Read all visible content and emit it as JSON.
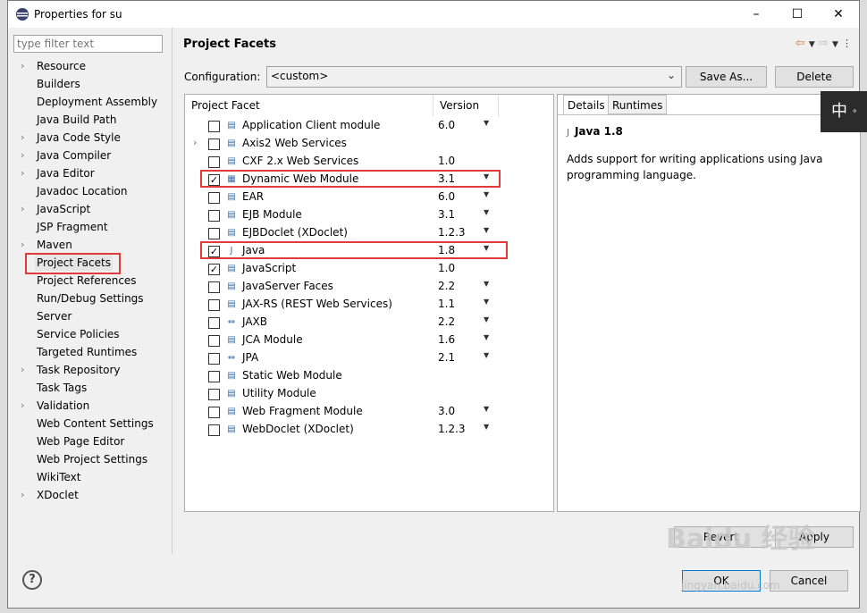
{
  "window": {
    "title": "Properties for su"
  },
  "filter": {
    "placeholder": "type filter text"
  },
  "nav": [
    {
      "label": "Resource",
      "expandable": true
    },
    {
      "label": "Builders",
      "expandable": false
    },
    {
      "label": "Deployment Assembly",
      "expandable": false
    },
    {
      "label": "Java Build Path",
      "expandable": false
    },
    {
      "label": "Java Code Style",
      "expandable": true
    },
    {
      "label": "Java Compiler",
      "expandable": true
    },
    {
      "label": "Java Editor",
      "expandable": true
    },
    {
      "label": "Javadoc Location",
      "expandable": false
    },
    {
      "label": "JavaScript",
      "expandable": true
    },
    {
      "label": "JSP Fragment",
      "expandable": false
    },
    {
      "label": "Maven",
      "expandable": true
    },
    {
      "label": "Project Facets",
      "expandable": false,
      "selected": true
    },
    {
      "label": "Project References",
      "expandable": false
    },
    {
      "label": "Run/Debug Settings",
      "expandable": false
    },
    {
      "label": "Server",
      "expandable": false
    },
    {
      "label": "Service Policies",
      "expandable": false
    },
    {
      "label": "Targeted Runtimes",
      "expandable": false
    },
    {
      "label": "Task Repository",
      "expandable": true
    },
    {
      "label": "Task Tags",
      "expandable": false
    },
    {
      "label": "Validation",
      "expandable": true
    },
    {
      "label": "Web Content Settings",
      "expandable": false
    },
    {
      "label": "Web Page Editor",
      "expandable": false
    },
    {
      "label": "Web Project Settings",
      "expandable": false
    },
    {
      "label": "WikiText",
      "expandable": false
    },
    {
      "label": "XDoclet",
      "expandable": true
    }
  ],
  "page": {
    "title": "Project Facets",
    "configuration_label": "Configuration:",
    "configuration_value": "<custom>",
    "save_as": "Save As...",
    "delete": "Delete"
  },
  "facets": {
    "col_facet": "Project Facet",
    "col_version": "Version",
    "rows": [
      {
        "label": "Application Client module",
        "version": "6.0",
        "checked": false,
        "dropdown": true,
        "expand": false,
        "icon": "file-icon"
      },
      {
        "label": "Axis2 Web Services",
        "version": "",
        "checked": false,
        "dropdown": false,
        "expand": true,
        "icon": "file-icon"
      },
      {
        "label": "CXF 2.x Web Services",
        "version": "1.0",
        "checked": false,
        "dropdown": false,
        "expand": false,
        "icon": "file-icon"
      },
      {
        "label": "Dynamic Web Module",
        "version": "3.1",
        "checked": true,
        "dropdown": true,
        "expand": false,
        "icon": "web-module-icon",
        "highlight": true
      },
      {
        "label": "EAR",
        "version": "6.0",
        "checked": false,
        "dropdown": true,
        "expand": false,
        "icon": "file-icon"
      },
      {
        "label": "EJB Module",
        "version": "3.1",
        "checked": false,
        "dropdown": true,
        "expand": false,
        "icon": "ejb-icon"
      },
      {
        "label": "EJBDoclet (XDoclet)",
        "version": "1.2.3",
        "checked": false,
        "dropdown": true,
        "expand": false,
        "icon": "file-icon"
      },
      {
        "label": "Java",
        "version": "1.8",
        "checked": true,
        "dropdown": true,
        "expand": false,
        "icon": "java-icon",
        "highlight": true
      },
      {
        "label": "JavaScript",
        "version": "1.0",
        "checked": true,
        "dropdown": false,
        "expand": false,
        "icon": "file-icon"
      },
      {
        "label": "JavaServer Faces",
        "version": "2.2",
        "checked": false,
        "dropdown": true,
        "expand": false,
        "icon": "file-icon"
      },
      {
        "label": "JAX-RS (REST Web Services)",
        "version": "1.1",
        "checked": false,
        "dropdown": true,
        "expand": false,
        "icon": "file-icon"
      },
      {
        "label": "JAXB",
        "version": "2.2",
        "checked": false,
        "dropdown": true,
        "expand": false,
        "icon": "jaxb-icon"
      },
      {
        "label": "JCA Module",
        "version": "1.6",
        "checked": false,
        "dropdown": true,
        "expand": false,
        "icon": "file-icon"
      },
      {
        "label": "JPA",
        "version": "2.1",
        "checked": false,
        "dropdown": true,
        "expand": false,
        "icon": "jpa-icon"
      },
      {
        "label": "Static Web Module",
        "version": "",
        "checked": false,
        "dropdown": false,
        "expand": false,
        "icon": "file-icon"
      },
      {
        "label": "Utility Module",
        "version": "",
        "checked": false,
        "dropdown": false,
        "expand": false,
        "icon": "file-icon"
      },
      {
        "label": "Web Fragment Module",
        "version": "3.0",
        "checked": false,
        "dropdown": true,
        "expand": false,
        "icon": "file-icon"
      },
      {
        "label": "WebDoclet (XDoclet)",
        "version": "1.2.3",
        "checked": false,
        "dropdown": true,
        "expand": false,
        "icon": "file-icon"
      }
    ]
  },
  "details": {
    "tab_details": "Details",
    "tab_runtimes": "Runtimes",
    "heading": "Java 1.8",
    "description": "Adds support for writing applications using Java programming language."
  },
  "buttons": {
    "revert": "Revert",
    "apply": "Apply",
    "ok": "OK",
    "cancel": "Cancel"
  },
  "ime": {
    "label": "中"
  },
  "watermark": {
    "text": "Baidu 经验",
    "url": "jingyan.baidu.com"
  },
  "colors": {
    "highlight": "#e03a3a",
    "accent": "#c08a1c"
  }
}
